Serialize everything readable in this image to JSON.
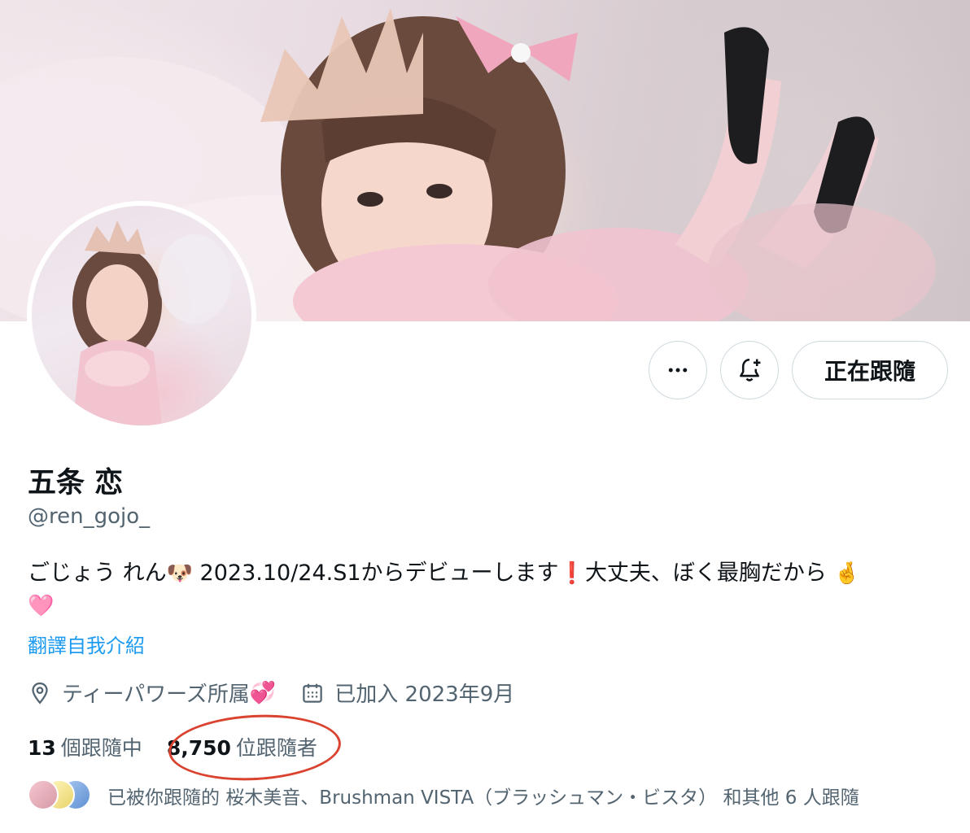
{
  "profile": {
    "display_name": "五条 恋",
    "handle": "@ren_gojo_",
    "bio_part1": "ごじょう れん",
    "bio_emoji_dog": "🐶",
    "bio_part2": " 2023.10/24.S1からデビューします",
    "bio_emoji_exclaim": "❗",
    "bio_part3": "大丈夫、ぼく最胸だから ",
    "bio_emoji_fingers": "🤞",
    "bio_emoji_heart": "🩷",
    "translate_link": "翻譯自我介紹",
    "location": "ティーパワーズ所属",
    "location_emoji": "💞",
    "joined": "已加入 2023年9月"
  },
  "actions": {
    "more_icon": "more-horizontal-icon",
    "notify_icon": "bell-plus-icon",
    "following_label": "正在跟隨"
  },
  "stats": {
    "following_count": "13",
    "following_label": "個跟隨中",
    "followers_count": "8,750",
    "followers_label": "位跟隨者"
  },
  "followed_by": {
    "text": "已被你跟隨的 桜木美音、Brushman VISTA（ブラッシュマン・ビスタ） 和其他 6 人跟隨"
  },
  "colors": {
    "link": "#1d9bf0",
    "secondary_text": "#536471",
    "annotation": "#d9432f",
    "border": "#cfd9de"
  }
}
